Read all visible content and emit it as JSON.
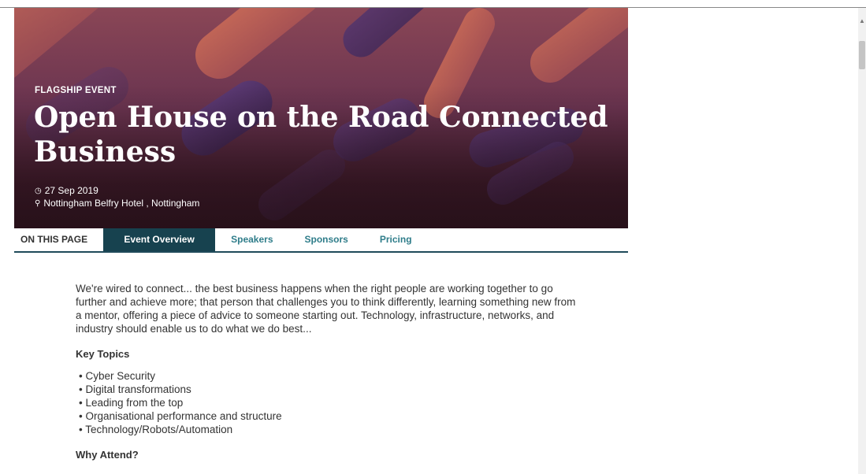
{
  "hero": {
    "kicker": "FLAGSHIP EVENT",
    "title": "Open House on the Road Connected Business",
    "date": "27 Sep 2019",
    "location": "Nottingham Belfry Hotel , Nottingham"
  },
  "icons": {
    "date": "clock-icon",
    "location": "map-marker-icon"
  },
  "tabs": {
    "label": "ON THIS PAGE",
    "items": [
      {
        "label": "Event Overview",
        "active": true
      },
      {
        "label": "Speakers",
        "active": false
      },
      {
        "label": "Sponsors",
        "active": false
      },
      {
        "label": "Pricing",
        "active": false
      }
    ]
  },
  "content": {
    "intro": "We're wired to connect... the best business happens when the right people are working together to go further and achieve more; that person that challenges you to think differently, learning something new from a mentor, offering a piece of advice to someone starting out. Technology, infrastructure, networks, and industry should enable us to do what we do best...",
    "key_topics_heading": "Key Topics",
    "topics": [
      "Cyber Security",
      "Digital transformations",
      "Leading from the top",
      "Organisational performance and structure",
      "Technology/Robots/Automation"
    ],
    "why_attend_heading": "Why Attend?"
  },
  "colors": {
    "tab_active_bg": "#17424f",
    "tab_link": "#2f7d8a",
    "hero_accent": "#d8745a"
  }
}
